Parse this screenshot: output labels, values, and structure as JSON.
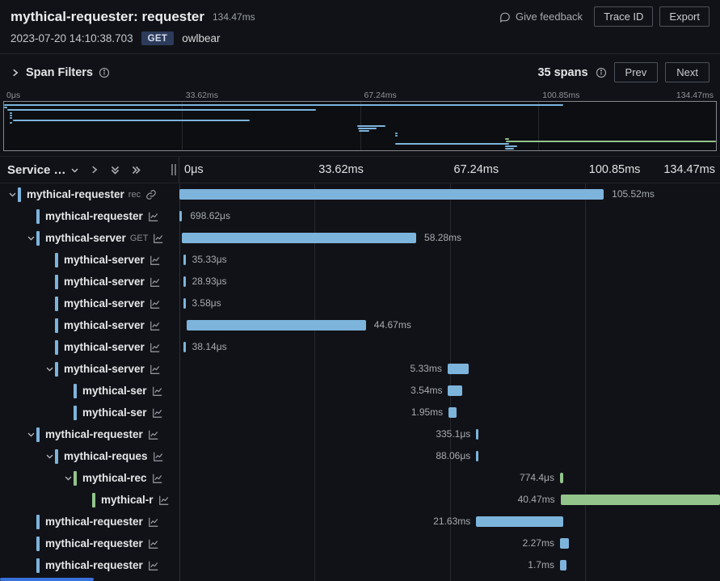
{
  "header": {
    "title": "mythical-requester: requester",
    "duration": "134.47ms",
    "timestamp": "2023-07-20 14:10:38.703",
    "method_badge": "GET",
    "target": "owlbear",
    "give_feedback": "Give feedback",
    "trace_id_button": "Trace ID",
    "export_button": "Export"
  },
  "span_filters": {
    "label": "Span Filters",
    "span_count": "35 spans",
    "prev": "Prev",
    "next": "Next"
  },
  "timeline": {
    "ticks": [
      "0μs",
      "33.62ms",
      "67.24ms",
      "100.85ms",
      "134.47ms"
    ]
  },
  "waterfall": {
    "service_header": "Service …",
    "rows": [
      {
        "service": "mythical-requester",
        "op": "rec",
        "indent": 0,
        "expandable": true,
        "color": "blue",
        "start_pct": 0,
        "width_pct": 78.5,
        "duration": "105.52ms",
        "label_side": "right",
        "icon": "link"
      },
      {
        "service": "mythical-requester",
        "op": "",
        "indent": 1,
        "expandable": false,
        "color": "blue",
        "start_pct": 0,
        "width_pct": 0.5,
        "duration": "698.62μs",
        "label_side": "right",
        "icon": "chart"
      },
      {
        "service": "mythical-server",
        "op": "GET",
        "indent": 1,
        "expandable": true,
        "color": "blue",
        "start_pct": 0.5,
        "width_pct": 43.3,
        "duration": "58.28ms",
        "label_side": "right",
        "icon": "chart"
      },
      {
        "service": "mythical-server",
        "op": "",
        "indent": 2,
        "expandable": false,
        "color": "blue",
        "start_pct": 0.8,
        "width_pct": 0.05,
        "duration": "35.33μs",
        "label_side": "right",
        "icon": "chart"
      },
      {
        "service": "mythical-server",
        "op": "",
        "indent": 2,
        "expandable": false,
        "color": "blue",
        "start_pct": 0.8,
        "width_pct": 0.04,
        "duration": "28.93μs",
        "label_side": "right",
        "icon": "chart"
      },
      {
        "service": "mythical-server",
        "op": "",
        "indent": 2,
        "expandable": false,
        "color": "blue",
        "start_pct": 0.8,
        "width_pct": 0.01,
        "duration": "3.58μs",
        "label_side": "right",
        "icon": "chart"
      },
      {
        "service": "mythical-server",
        "op": "",
        "indent": 2,
        "expandable": false,
        "color": "blue",
        "start_pct": 1.3,
        "width_pct": 33.2,
        "duration": "44.67ms",
        "label_side": "right",
        "icon": "chart"
      },
      {
        "service": "mythical-server",
        "op": "",
        "indent": 2,
        "expandable": false,
        "color": "blue",
        "start_pct": 0.8,
        "width_pct": 0.05,
        "duration": "38.14μs",
        "label_side": "right",
        "icon": "chart"
      },
      {
        "service": "mythical-server",
        "op": "",
        "indent": 2,
        "expandable": true,
        "color": "blue",
        "start_pct": 49.6,
        "width_pct": 3.96,
        "duration": "5.33ms",
        "label_side": "left",
        "icon": "chart"
      },
      {
        "service": "mythical-ser",
        "op": "",
        "indent": 3,
        "expandable": false,
        "color": "blue",
        "start_pct": 49.7,
        "width_pct": 2.63,
        "duration": "3.54ms",
        "label_side": "left",
        "icon": "chart"
      },
      {
        "service": "mythical-ser",
        "op": "",
        "indent": 3,
        "expandable": false,
        "color": "blue",
        "start_pct": 49.8,
        "width_pct": 1.45,
        "duration": "1.95ms",
        "label_side": "left",
        "icon": "chart"
      },
      {
        "service": "mythical-requester",
        "op": "",
        "indent": 1,
        "expandable": true,
        "color": "blue",
        "start_pct": 54.9,
        "width_pct": 0.25,
        "duration": "335.1μs",
        "label_side": "left",
        "icon": "chart"
      },
      {
        "service": "mythical-reques",
        "op": "",
        "indent": 2,
        "expandable": true,
        "color": "blue",
        "start_pct": 54.9,
        "width_pct": 0.07,
        "duration": "88.06μs",
        "label_side": "left",
        "icon": "chart"
      },
      {
        "service": "mythical-rec",
        "op": "",
        "indent": 3,
        "expandable": true,
        "color": "green",
        "start_pct": 70.4,
        "width_pct": 0.58,
        "duration": "774.4μs",
        "label_side": "left",
        "icon": "chart"
      },
      {
        "service": "mythical-r",
        "op": "",
        "indent": 4,
        "expandable": false,
        "color": "green",
        "start_pct": 70.5,
        "width_pct": 29.5,
        "duration": "40.47ms",
        "label_side": "left",
        "icon": "chart"
      },
      {
        "service": "mythical-requester",
        "op": "",
        "indent": 1,
        "expandable": false,
        "color": "blue",
        "start_pct": 54.9,
        "width_pct": 16.1,
        "duration": "21.63ms",
        "label_side": "left",
        "icon": "chart"
      },
      {
        "service": "mythical-requester",
        "op": "",
        "indent": 1,
        "expandable": false,
        "color": "blue",
        "start_pct": 70.4,
        "width_pct": 1.69,
        "duration": "2.27ms",
        "label_side": "left",
        "icon": "chart"
      },
      {
        "service": "mythical-requester",
        "op": "",
        "indent": 1,
        "expandable": false,
        "color": "blue",
        "start_pct": 70.4,
        "width_pct": 1.26,
        "duration": "1.7ms",
        "label_side": "left",
        "icon": "chart"
      }
    ]
  },
  "colors": {
    "span_blue": "#7db4dc",
    "span_green": "#93c48c",
    "accent_blue": "#3871dc",
    "badge_bg": "#2c3b5a"
  }
}
